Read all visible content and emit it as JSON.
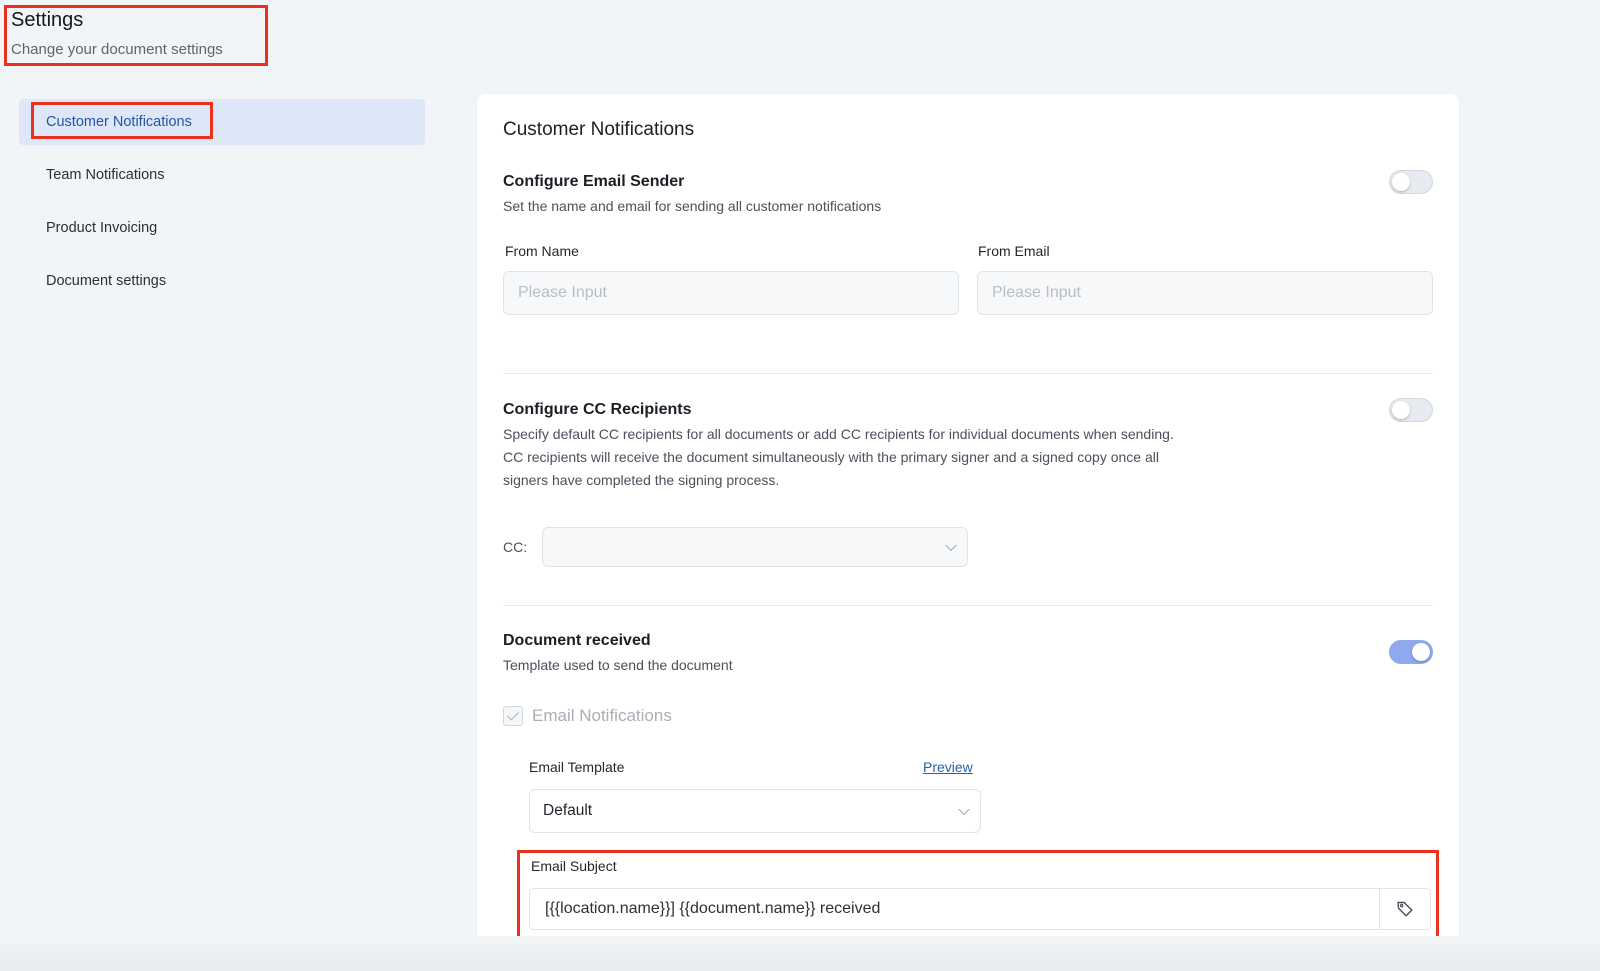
{
  "header": {
    "title": "Settings",
    "subtitle": "Change your document settings"
  },
  "sidebar": {
    "items": [
      {
        "label": "Customer Notifications",
        "active": true
      },
      {
        "label": "Team Notifications"
      },
      {
        "label": "Product Invoicing"
      },
      {
        "label": "Document settings"
      }
    ]
  },
  "main": {
    "title": "Customer Notifications",
    "email_sender": {
      "title": "Configure Email Sender",
      "description": "Set the name and email for sending all customer notifications",
      "enabled": false,
      "from_name_label": "From Name",
      "from_name_placeholder": "Please Input",
      "from_email_label": "From Email",
      "from_email_placeholder": "Please Input"
    },
    "cc_recipients": {
      "title": "Configure CC Recipients",
      "description_lines": [
        "Specify default CC recipients for all documents or add CC recipients for individual documents when sending.",
        "CC recipients will receive the document simultaneously with the primary signer and a signed copy once all",
        "signers have completed the signing process."
      ],
      "enabled": false,
      "cc_label": "CC:",
      "cc_value": ""
    },
    "document_received": {
      "title": "Document received",
      "description": "Template used to send the document",
      "enabled": true,
      "email_notifications_label": "Email Notifications",
      "email_notifications_checked": true,
      "email_template_label": "Email Template",
      "preview_label": "Preview",
      "email_template_value": "Default",
      "email_subject_label": "Email Subject",
      "email_subject_value": "[{{location.name}}] {{document.name}} received"
    }
  },
  "icons": {
    "chevron": "chevron-down-icon",
    "tag": "tag-icon",
    "check": "check-icon"
  },
  "colors": {
    "accent": "#2456a6",
    "active_bg": "#dde7f7",
    "toggle_on": "#8fa9ee",
    "annotation": "#e8321e"
  }
}
